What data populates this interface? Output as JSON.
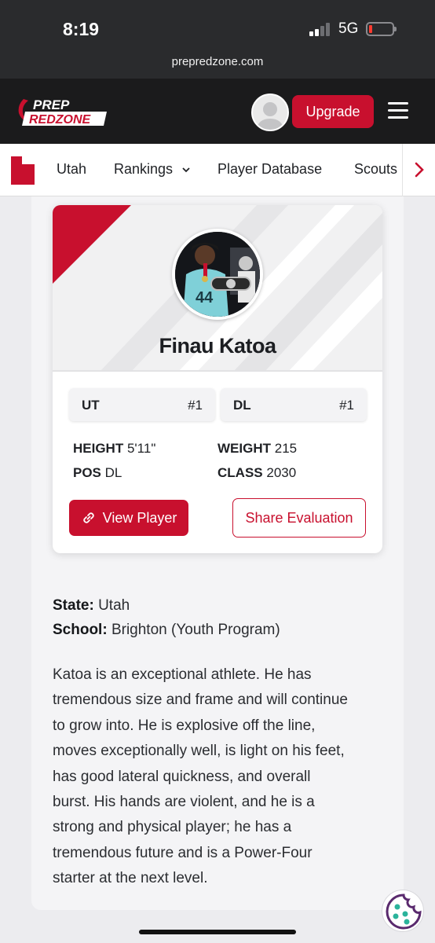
{
  "status_bar": {
    "time": "8:19",
    "network": "5G"
  },
  "browser": {
    "url": "prepredzone.com"
  },
  "header": {
    "logo_top": "PREP",
    "logo_bottom": "REDZONE",
    "upgrade_label": "Upgrade"
  },
  "nav": {
    "items": [
      "Utah",
      "Rankings",
      "Player Database",
      "Scouts"
    ]
  },
  "player": {
    "name": "Finau Katoa",
    "rank_state": {
      "label": "UT",
      "rank": "#1"
    },
    "rank_position": {
      "label": "DL",
      "rank": "#1"
    },
    "height_label": "HEIGHT",
    "height": "5'11\"",
    "weight_label": "WEIGHT",
    "weight": "215",
    "pos_label": "POS",
    "pos": "DL",
    "class_label": "CLASS",
    "class": "2030",
    "view_label": "View Player",
    "share_label": "Share Evaluation"
  },
  "details": {
    "state_label": "State:",
    "state": "Utah",
    "school_label": "School:",
    "school": "Brighton (Youth Program)",
    "bio_lines": [
      "Katoa is an exceptional athlete. He has",
      "tremendous size and frame and will continue",
      "to grow into. He is explosive off the line,",
      "moves exceptionally well, is light on his feet,",
      "has good lateral quickness, and overall",
      "burst. His hands are violent, and he is a",
      "strong and physical player; he has a",
      "tremendous future and is a Power-Four",
      "starter at the next level."
    ]
  },
  "colors": {
    "brand_red": "#c8102e",
    "header_dark": "#1b1b1c"
  }
}
